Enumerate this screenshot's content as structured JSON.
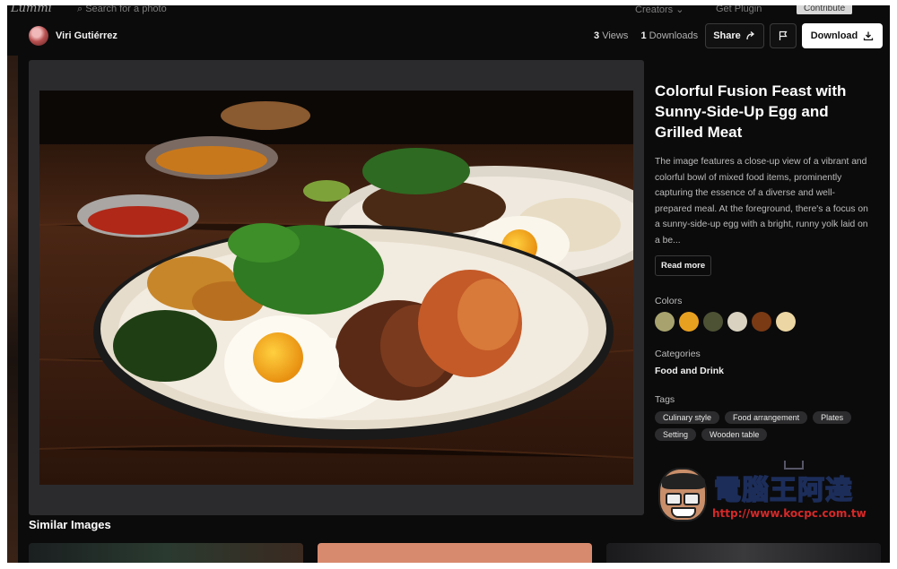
{
  "topnav": {
    "logo": "Lummi",
    "search_placeholder": "Search for a photo",
    "creators": "Creators",
    "get_plugin": "Get Plugin",
    "contribute": "Contribute"
  },
  "author": {
    "name": "Viri Gutiérrez"
  },
  "stats": {
    "views_count": "3",
    "views_label": "Views",
    "downloads_count": "1",
    "downloads_label": "Downloads"
  },
  "actions": {
    "share": "Share",
    "download": "Download"
  },
  "image": {
    "title": "Colorful Fusion Feast with Sunny-Side-Up Egg and Grilled Meat",
    "description": "The image features a close-up view of a vibrant and colorful bowl of mixed food items, prominently capturing the essence of a diverse and well-prepared meal. At the foreground, there's a focus on a sunny-side-up egg with a bright, runny yolk laid on a be...",
    "read_more": "Read more"
  },
  "colors": {
    "label": "Colors",
    "swatches": [
      "#a8a36e",
      "#e8a020",
      "#4e5235",
      "#d9d2c0",
      "#7a3a14",
      "#ecd6a3"
    ]
  },
  "categories": {
    "label": "Categories",
    "value": "Food and Drink"
  },
  "tags": {
    "label": "Tags",
    "items": [
      "Culinary style",
      "Food arrangement",
      "Plates",
      "Setting",
      "Wooden table"
    ]
  },
  "similar": {
    "label": "Similar Images"
  },
  "watermark": {
    "text": "電腦王阿達",
    "url": "http://www.kocpc.com.tw"
  }
}
